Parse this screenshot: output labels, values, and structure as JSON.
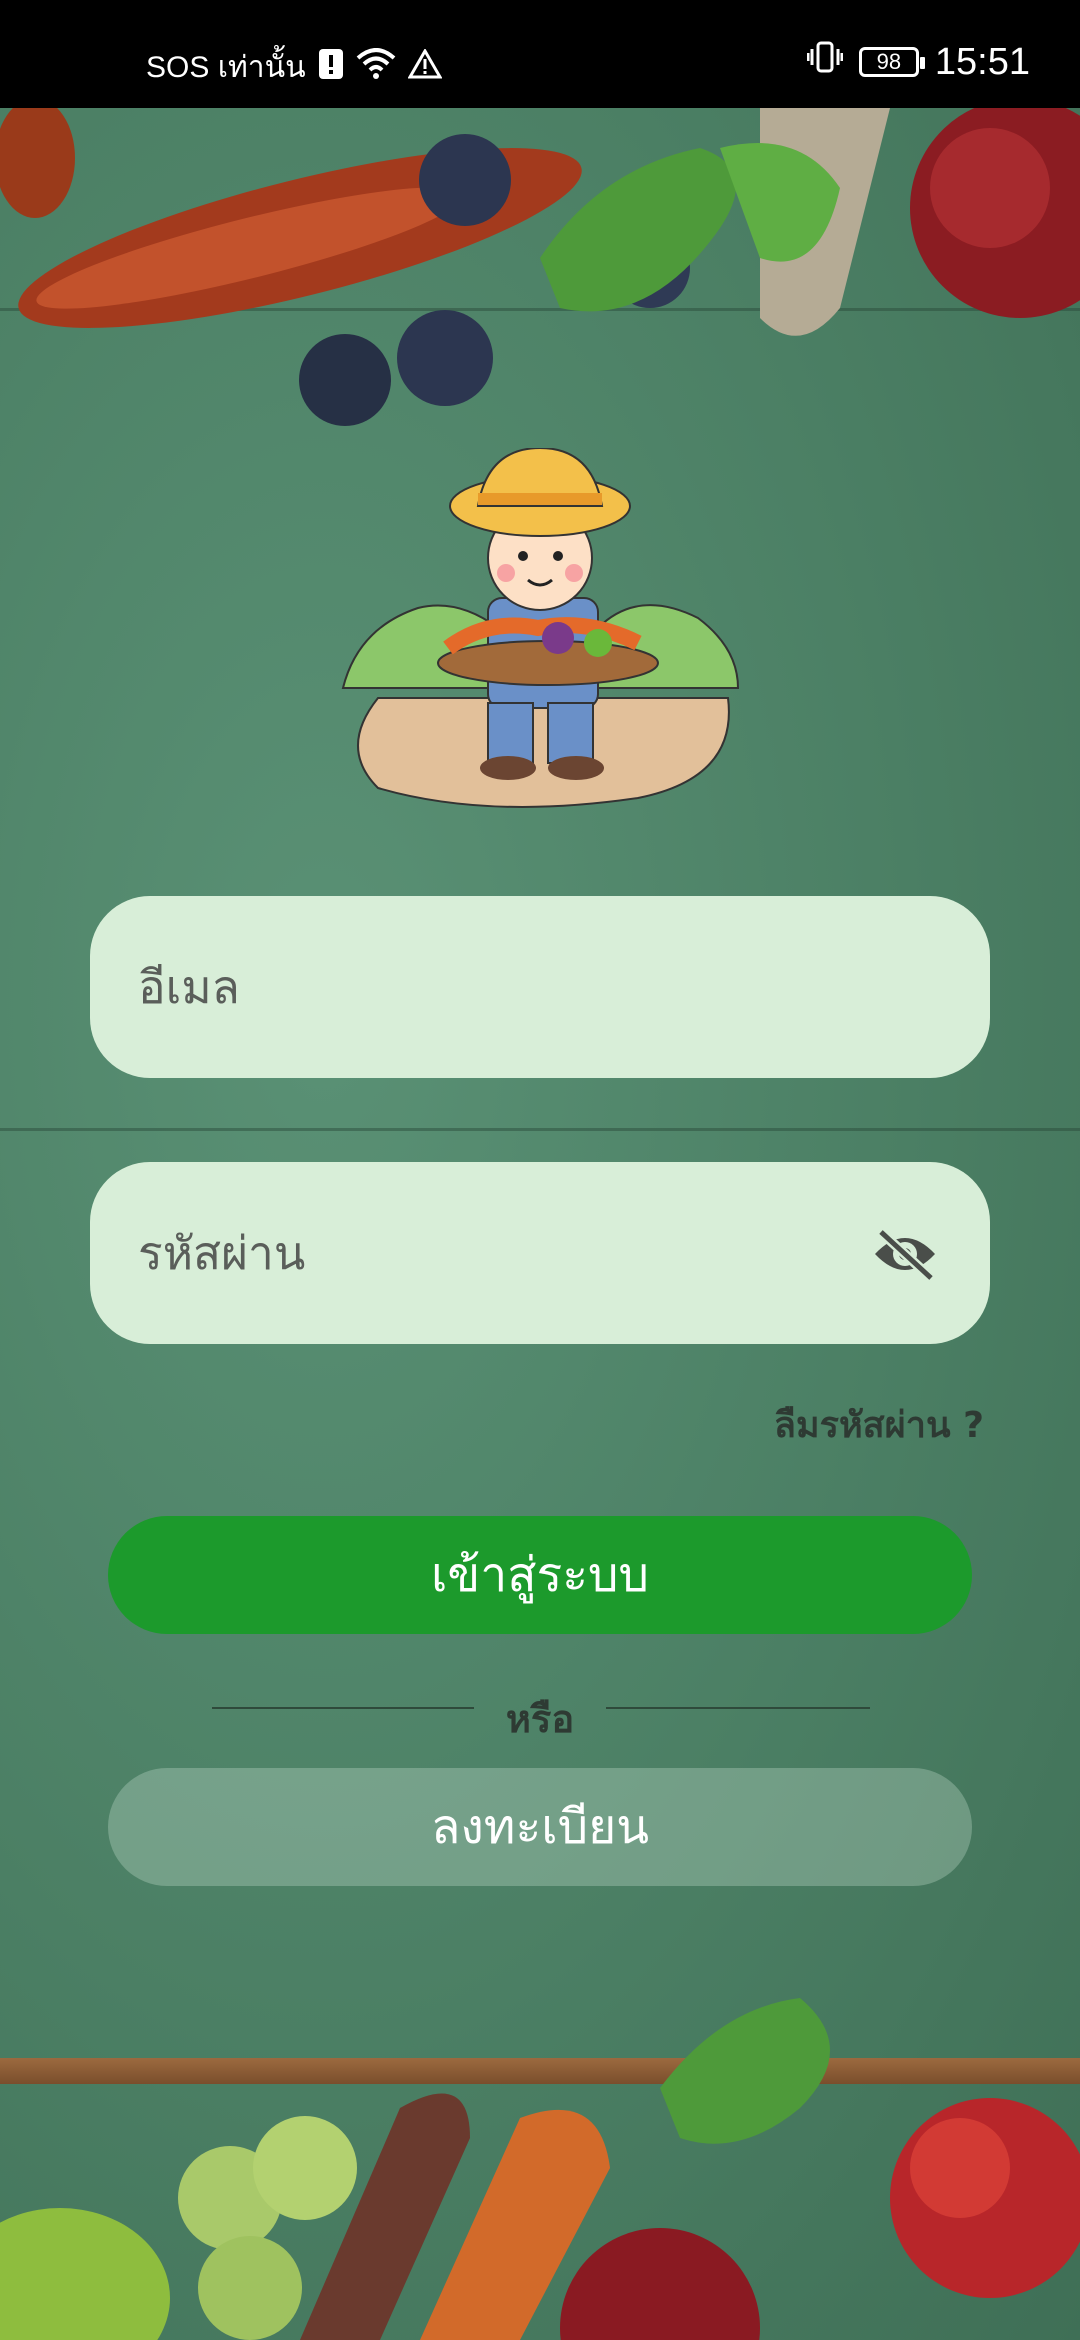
{
  "status_bar": {
    "carrier": "SOS เท่านั้น",
    "battery": "98",
    "time": "15:51"
  },
  "form": {
    "email_placeholder": "อีเมล",
    "password_placeholder": "รหัสผ่าน",
    "forgot_password": "ลืมรหัสผ่าน ?",
    "login_label": "เข้าสู่ระบบ",
    "or_label": "หรือ",
    "register_label": "ลงทะเบียน"
  },
  "colors": {
    "primary": "#1c9a2c",
    "field_bg": "#d8eed8",
    "background": "#4e8468"
  },
  "icons": {
    "password_toggle": "eye-off-icon"
  }
}
